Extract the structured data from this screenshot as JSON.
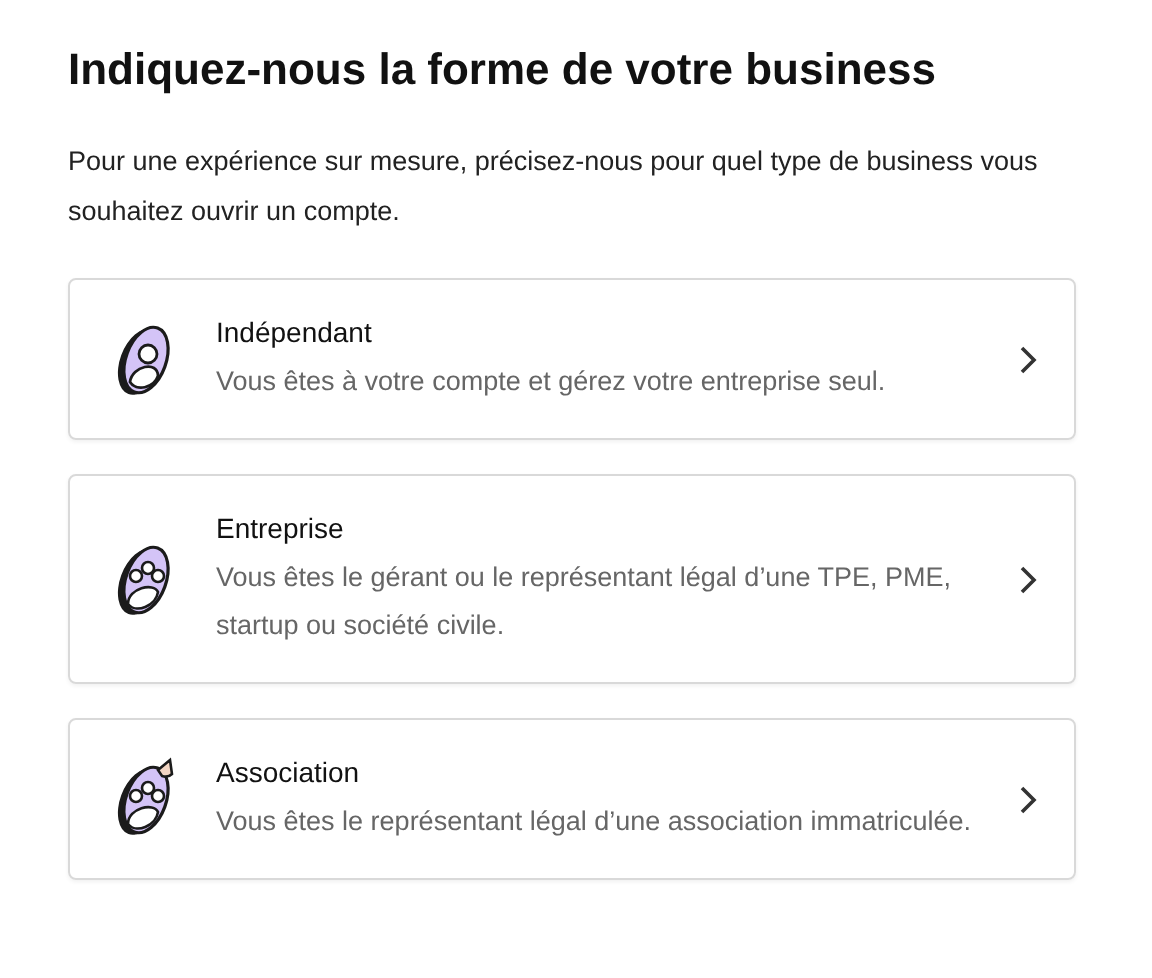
{
  "title": "Indiquez-nous la forme de votre business",
  "intro": "Pour une expérience sur mesure, précisez-nous pour quel type de business vous souhaitez ouvrir un compte.",
  "options": [
    {
      "kind": "person",
      "label": "Indépendant",
      "description": "Vous êtes à votre compte et gérez votre entreprise seul."
    },
    {
      "kind": "group",
      "label": "Entreprise",
      "description": "Vous êtes le gérant ou le représentant légal d’une TPE, PME, startup ou société civile."
    },
    {
      "kind": "group-pin",
      "label": "Association",
      "description": "Vous êtes le représentant légal d’une association immatriculée."
    }
  ]
}
